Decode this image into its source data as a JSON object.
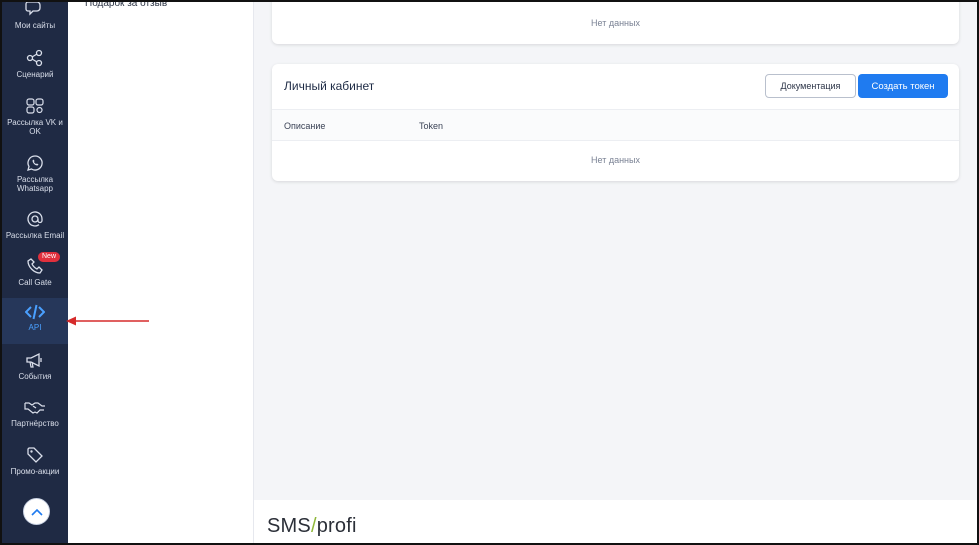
{
  "sidebar": {
    "items": [
      {
        "label": "Мои сайты",
        "icon": "chat-bubbles-icon"
      },
      {
        "label": "Сценарий",
        "icon": "share-nodes-icon"
      },
      {
        "label": "Рассылка VK и OK",
        "icon": "vk-ok-icon"
      },
      {
        "label": "Рассылка Whatsapp",
        "icon": "whatsapp-icon"
      },
      {
        "label": "Рассылка Email",
        "icon": "at-sign-icon"
      },
      {
        "label": "Call Gate",
        "icon": "phone-icon",
        "badge": "New"
      },
      {
        "label": "API",
        "icon": "code-icon",
        "active": true
      },
      {
        "label": "События",
        "icon": "megaphone-icon"
      },
      {
        "label": "Партнёрство",
        "icon": "handshake-icon"
      },
      {
        "label": "Промо-акции",
        "icon": "tag-icon"
      }
    ],
    "scroll_up_icon": "chevron-up-icon"
  },
  "submenu": {
    "item": "Подарок за отзыв"
  },
  "top_card": {
    "empty_text": "Нет данных"
  },
  "cabinet_card": {
    "title": "Личный кабинет",
    "docs_button": "Документация",
    "create_button": "Создать токен",
    "columns": [
      "Описание",
      "Token"
    ],
    "empty_text": "Нет данных"
  },
  "footer": {
    "logo_left": "SMS",
    "logo_slash": "/",
    "logo_right": "profi"
  },
  "colors": {
    "sidebar_bg": "#1f2a44",
    "accent": "#1f7bf0",
    "badge": "#e0303d",
    "annotation_arrow": "#d62b2b"
  }
}
